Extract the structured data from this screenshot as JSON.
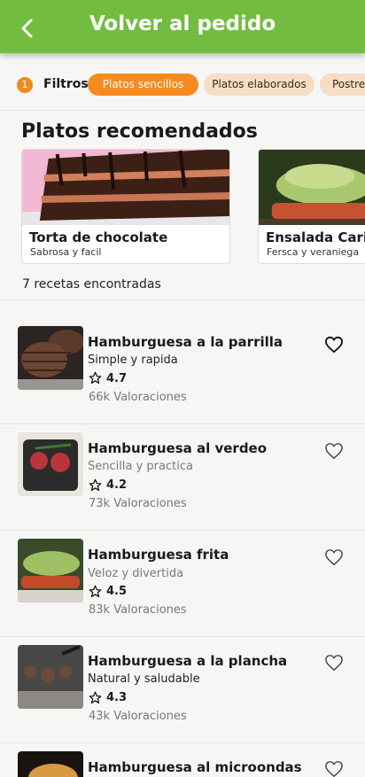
{
  "header": {
    "title": "Volver al pedido",
    "back_icon": "chevron-left-icon"
  },
  "filters": {
    "count": "1",
    "label": "Filtros",
    "chips": [
      {
        "label": "Platos sencillos",
        "active": true
      },
      {
        "label": "Platos elaborados",
        "active": false
      },
      {
        "label": "Postres",
        "active": false
      }
    ]
  },
  "recommended": {
    "title": "Platos recomendados",
    "cards": [
      {
        "title": "Torta de chocolate",
        "subtitle": "Sabrosa y facil"
      },
      {
        "title": "Ensalada Caribeña",
        "subtitle": "Fersca y veraniega"
      }
    ]
  },
  "results": {
    "count_label": "7 recetas encontradas",
    "recipes": [
      {
        "title": "Hamburguesa a la parrilla",
        "subtitle": "Simple y rapida",
        "rating": "4.7",
        "votes": "66k Valoraciones"
      },
      {
        "title": "Hamburguesa al verdeo",
        "subtitle": "Sencilla y practica",
        "rating": "4.2",
        "votes": "73k Valoraciones"
      },
      {
        "title": "Hamburguesa frita",
        "subtitle": "Veloz y divertida",
        "rating": "4.5",
        "votes": "83k Valoraciones"
      },
      {
        "title": "Hamburguesa a la plancha",
        "subtitle": "Natural y saludable",
        "rating": "4.3",
        "votes": "43k Valoraciones"
      },
      {
        "title": "Hamburguesa al microondas",
        "subtitle": "",
        "rating": "",
        "votes": ""
      }
    ]
  },
  "colors": {
    "header": "#72bd3f",
    "accent": "#f58a1f",
    "chip_inactive": "#f7dcc6"
  }
}
